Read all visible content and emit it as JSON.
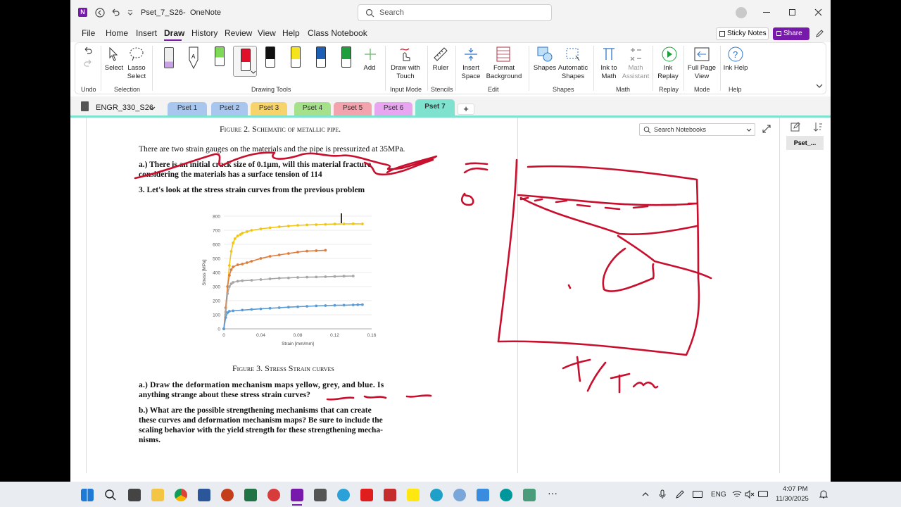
{
  "title": {
    "file": "Pset_7_S26",
    "app": "OneNote",
    "search": "Search"
  },
  "menu": [
    "File",
    "Home",
    "Insert",
    "Draw",
    "History",
    "Review",
    "View",
    "Help",
    "Class Notebook"
  ],
  "right_buttons": {
    "sticky": "Sticky Notes",
    "share": "Share"
  },
  "ribbon": {
    "undo": "Undo",
    "select": "Select",
    "lasso": "Lasso Select",
    "selection": "Selection",
    "drawing_tools": "Drawing Tools",
    "add": "Add",
    "draw_touch": "Draw with Touch",
    "input_mode": "Input Mode",
    "ruler": "Ruler",
    "stencils": "Stencils",
    "insert_space": "Insert Space",
    "format_bg": "Format Background",
    "edit": "Edit",
    "shapes": "Shapes",
    "auto_shapes": "Automatic Shapes",
    "shapes_group": "Shapes",
    "ink_math": "Ink to Math",
    "math_asst": "Math Assistant",
    "math": "Math",
    "ink_replay": "Ink Replay",
    "replay": "Replay",
    "full_page": "Full Page View",
    "mode": "Mode",
    "ink_help": "Ink Help",
    "help": "Help"
  },
  "notebook": "ENGR_330_S26",
  "sections": [
    "Pset 1",
    "Pset 2",
    "Pset 3",
    "Pset 4",
    "Pset 5",
    "Pset 6",
    "Pset 7"
  ],
  "section_colors": [
    "#a9c7ee",
    "#a9c7ee",
    "#f6d36b",
    "#a5e08a",
    "#f3a3ad",
    "#e7a6ef",
    "#7ee2cf"
  ],
  "search_notebooks": "Search Notebooks",
  "page_tab": "Pset_...",
  "doc": {
    "fig2": "Figure 2. Schematic of metallic pipe.",
    "p1": "There are two strain gauges on the materials and the pipe is pressurized at 35MPa.",
    "qa1": "a.)  There is an initial crack size of 0.1μm, will this material fracture",
    "qa2": "considering the materials has a surface tension of 114",
    "q3": "3. Let's look at the stress strain curves from the previous problem",
    "fig3": "Figure 3. Stress Strain curves",
    "a1": "a.)  Draw the deformation mechanism maps yellow, grey, and blue.  Is",
    "a2": "anything strange about these stress strain curves?",
    "b1": "b.)  What are the possible strengthening mechanisms that can create",
    "b2": "these curves and deformation mechanism maps? Be sure to include the",
    "b3": "scaling behavior with the yield strength for these strengthening mecha-",
    "b4": "nisms."
  },
  "chart_data": {
    "type": "line",
    "xlabel": "Strain [mm/mm]",
    "ylabel": "Stress [MPa]",
    "xlim": [
      0,
      0.16
    ],
    "ylim": [
      0,
      800
    ],
    "xticks": [
      "0",
      "0.04",
      "0.08",
      "0.12",
      "0.16"
    ],
    "yticks": [
      "0",
      "100",
      "200",
      "300",
      "400",
      "500",
      "600",
      "700",
      "800"
    ],
    "series": [
      {
        "color": "#f2c414",
        "x": [
          0,
          0.002,
          0.004,
          0.006,
          0.008,
          0.01,
          0.012,
          0.015,
          0.018,
          0.02,
          0.025,
          0.03,
          0.04,
          0.05,
          0.06,
          0.07,
          0.08,
          0.09,
          0.1,
          0.11,
          0.12,
          0.13,
          0.14,
          0.15
        ],
        "y": [
          0,
          100,
          300,
          450,
          550,
          610,
          640,
          660,
          670,
          680,
          690,
          700,
          710,
          718,
          725,
          730,
          735,
          738,
          740,
          742,
          744,
          745,
          746,
          745
        ]
      },
      {
        "color": "#e07b39",
        "x": [
          0,
          0.002,
          0.004,
          0.006,
          0.008,
          0.01,
          0.015,
          0.02,
          0.025,
          0.03,
          0.04,
          0.05,
          0.06,
          0.07,
          0.08,
          0.09,
          0.1,
          0.11
        ],
        "y": [
          0,
          150,
          300,
          380,
          420,
          440,
          455,
          460,
          470,
          480,
          500,
          515,
          525,
          535,
          545,
          552,
          555,
          558
        ]
      },
      {
        "color": "#a6a6a6",
        "x": [
          0,
          0.002,
          0.004,
          0.006,
          0.008,
          0.01,
          0.015,
          0.02,
          0.03,
          0.04,
          0.05,
          0.06,
          0.07,
          0.08,
          0.09,
          0.1,
          0.11,
          0.12,
          0.13,
          0.14
        ],
        "y": [
          0,
          120,
          250,
          300,
          320,
          330,
          338,
          342,
          345,
          350,
          355,
          360,
          362,
          365,
          367,
          368,
          370,
          372,
          374,
          375
        ]
      },
      {
        "color": "#5b9bd5",
        "x": [
          0,
          0.002,
          0.004,
          0.006,
          0.01,
          0.02,
          0.03,
          0.04,
          0.05,
          0.06,
          0.07,
          0.08,
          0.09,
          0.1,
          0.11,
          0.12,
          0.13,
          0.14,
          0.145,
          0.15
        ],
        "y": [
          0,
          80,
          115,
          125,
          128,
          133,
          138,
          142,
          146,
          150,
          154,
          157,
          160,
          163,
          165,
          167,
          168,
          170,
          171,
          172
        ]
      }
    ]
  },
  "taskbar": {
    "lang": "ENG",
    "time": "4:07 PM",
    "date": "11/30/2025"
  }
}
